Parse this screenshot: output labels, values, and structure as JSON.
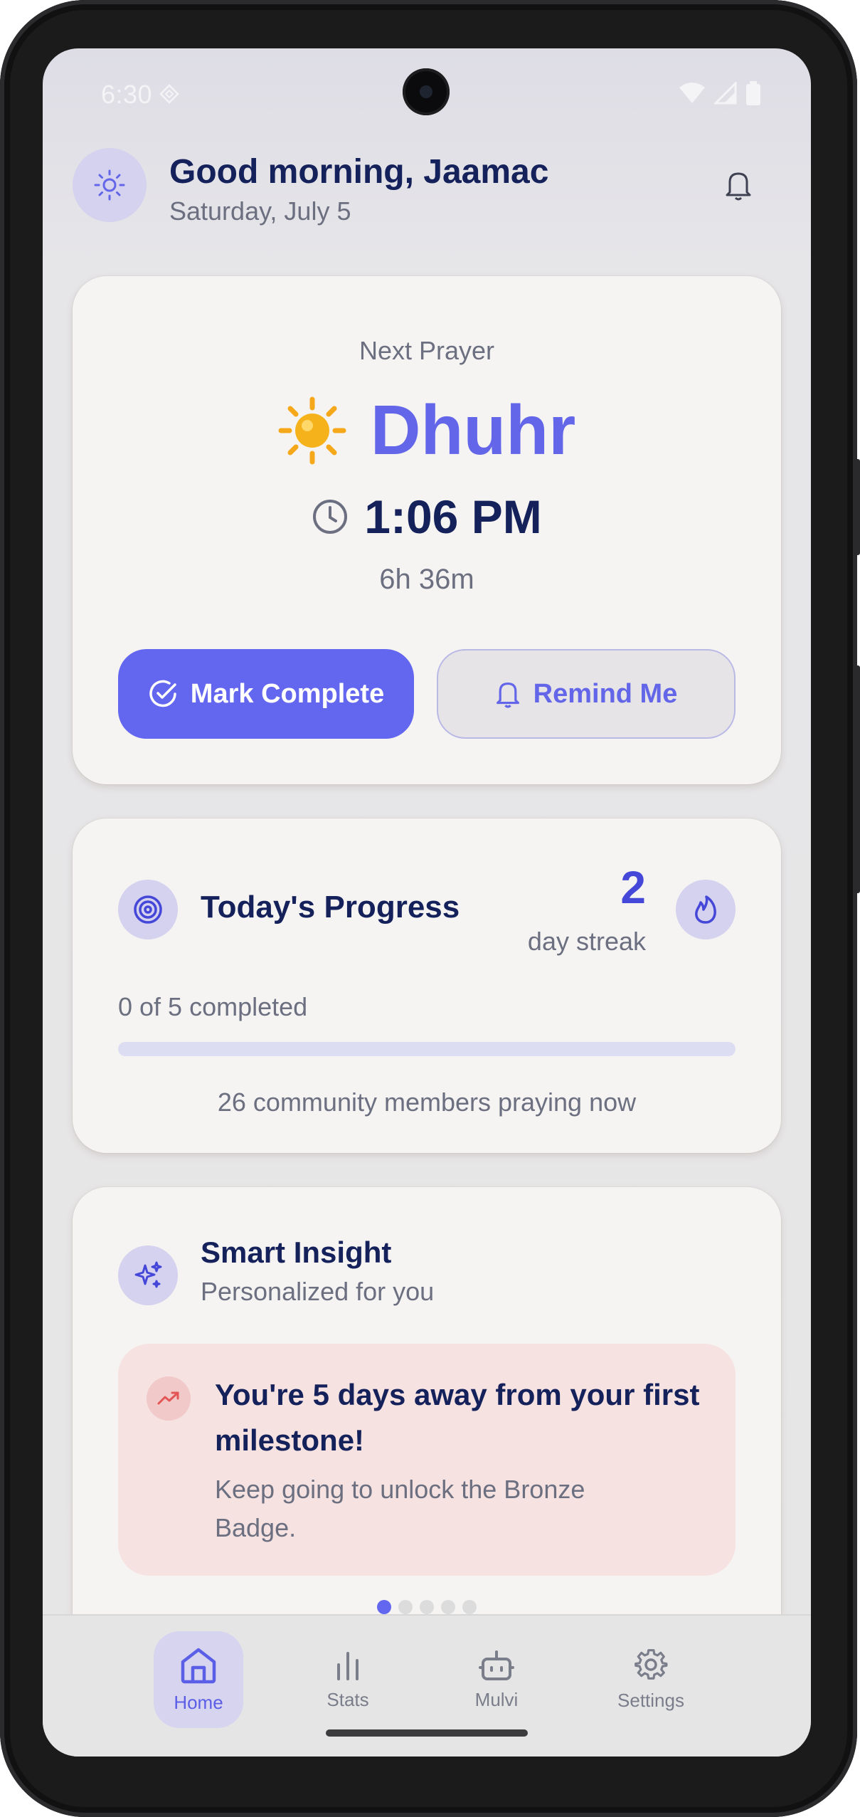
{
  "status_bar": {
    "time": "6:30"
  },
  "header": {
    "greeting": "Good morning, Jaamac",
    "date": "Saturday, July 5"
  },
  "next_prayer": {
    "label": "Next Prayer",
    "emoji": "☀️",
    "name": "Dhuhr",
    "time": "1:06 PM",
    "countdown": "6h 36m",
    "mark_complete_label": "Mark Complete",
    "remind_label": "Remind Me"
  },
  "progress": {
    "title": "Today's Progress",
    "streak_value": "2",
    "streak_label": "day streak",
    "completed_text": "0 of 5 completed",
    "completed_fraction": 0,
    "community_text": "26 community members praying now"
  },
  "insight": {
    "title": "Smart Insight",
    "subtitle": "Personalized for you",
    "card_heading": "You're 5 days away from your first milestone!",
    "card_body": "Keep going to unlock the Bronze Badge.",
    "pager_total": 5,
    "pager_active": 0
  },
  "nav": {
    "items": [
      {
        "label": "Home",
        "icon": "home-icon",
        "active": true
      },
      {
        "label": "Stats",
        "icon": "bar-chart-icon",
        "active": false
      },
      {
        "label": "Mulvi",
        "icon": "bot-icon",
        "active": false
      },
      {
        "label": "Settings",
        "icon": "gear-icon",
        "active": false
      }
    ]
  },
  "colors": {
    "accent": "#6366EF",
    "heading": "#14215A",
    "muted": "#6B6F80",
    "sun": "#F6B21B",
    "milestone_bg": "#F5E2E1"
  }
}
